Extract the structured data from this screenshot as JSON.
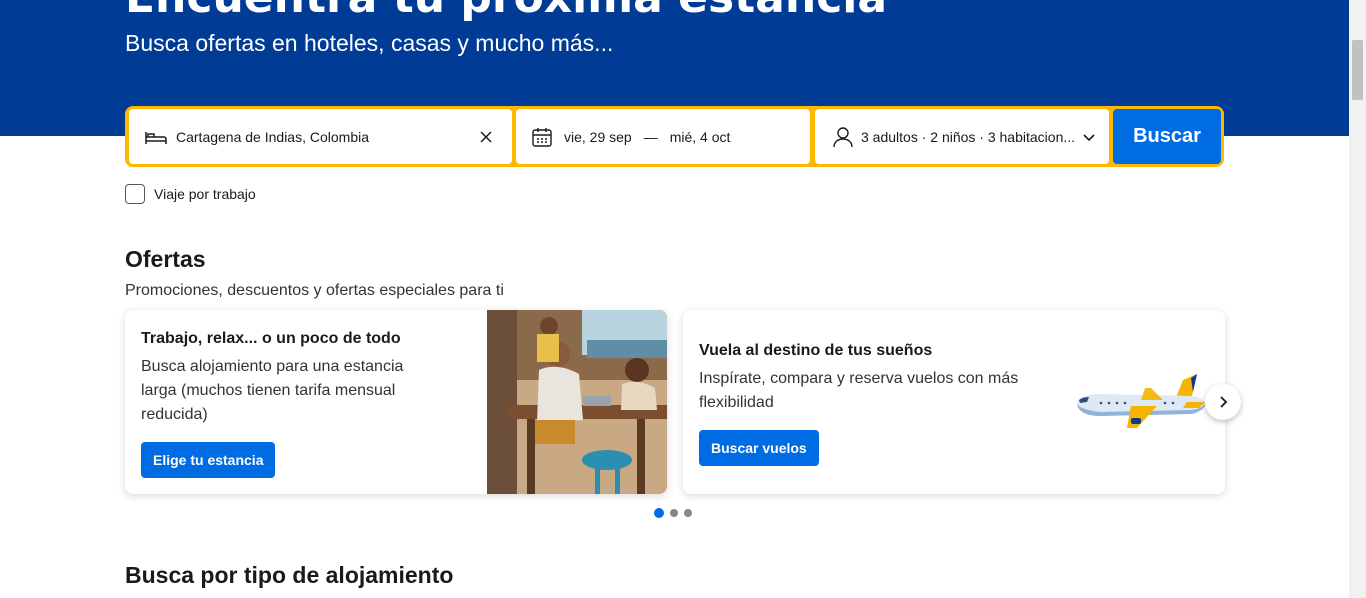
{
  "hero": {
    "title": "Encuentra tu próxima estancia",
    "subtitle": "Busca ofertas en hoteles, casas y mucho más..."
  },
  "search": {
    "destination": "Cartagena de Indias, Colombia",
    "checkin": "vie, 29 sep",
    "separator": "—",
    "checkout": "mié, 4 oct",
    "guests": "3 adultos · 2 niños · 3 habitacion...",
    "button": "Buscar"
  },
  "work_trip": {
    "label": "Viaje por trabajo",
    "checked": false
  },
  "offers": {
    "title": "Ofertas",
    "subtitle": "Promociones, descuentos y ofertas especiales para ti",
    "cards": [
      {
        "title": "Trabajo, relax... o un poco de todo",
        "text": "Busca alojamiento para una estancia larga (muchos tienen tarifa mensual reducida)",
        "button": "Elige tu estancia"
      },
      {
        "title": "Vuela al destino de tus sueños",
        "text": "Inspírate, compara y reserva vuelos con más flexibilidad",
        "button": "Buscar vuelos"
      }
    ],
    "pagination": {
      "pages": 3,
      "active": 1
    }
  },
  "types_section": {
    "title": "Busca por tipo de alojamiento"
  },
  "colors": {
    "brand_dark": "#003b95",
    "accent_yellow": "#ffb700",
    "action_blue": "#006ce4"
  },
  "icons": [
    "bed-icon",
    "close-icon",
    "calendar-icon",
    "person-icon",
    "chevron-down-icon",
    "chevron-right-icon"
  ]
}
